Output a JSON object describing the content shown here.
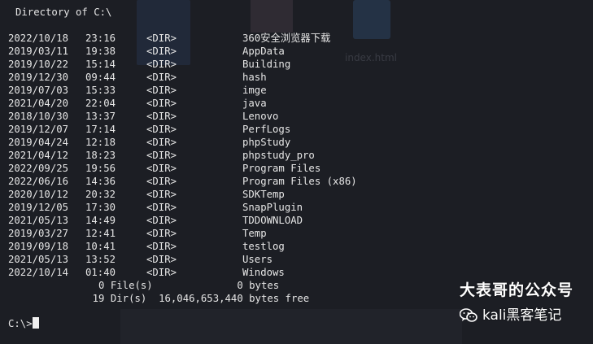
{
  "terminal": {
    "header": "Directory of C:\\",
    "tag": "<DIR>",
    "entries": [
      {
        "date": "2022/10/18",
        "time": "23:16",
        "name": "360安全浏览器下载"
      },
      {
        "date": "2019/03/11",
        "time": "19:38",
        "name": "AppData"
      },
      {
        "date": "2019/10/22",
        "time": "15:14",
        "name": "Building"
      },
      {
        "date": "2019/12/30",
        "time": "09:44",
        "name": "hash"
      },
      {
        "date": "2019/07/03",
        "time": "15:33",
        "name": "imge"
      },
      {
        "date": "2021/04/20",
        "time": "22:04",
        "name": "java"
      },
      {
        "date": "2018/10/30",
        "time": "13:37",
        "name": "Lenovo"
      },
      {
        "date": "2019/12/07",
        "time": "17:14",
        "name": "PerfLogs"
      },
      {
        "date": "2019/04/24",
        "time": "12:18",
        "name": "phpStudy"
      },
      {
        "date": "2021/04/12",
        "time": "18:23",
        "name": "phpstudy_pro"
      },
      {
        "date": "2022/09/25",
        "time": "19:56",
        "name": "Program Files"
      },
      {
        "date": "2022/06/16",
        "time": "14:36",
        "name": "Program Files (x86)"
      },
      {
        "date": "2020/10/12",
        "time": "20:32",
        "name": "SDKTemp"
      },
      {
        "date": "2019/12/05",
        "time": "17:30",
        "name": "SnapPlugin"
      },
      {
        "date": "2021/05/13",
        "time": "14:49",
        "name": "TDDOWNLOAD"
      },
      {
        "date": "2019/03/27",
        "time": "12:41",
        "name": "Temp"
      },
      {
        "date": "2019/09/18",
        "time": "10:41",
        "name": "testlog"
      },
      {
        "date": "2021/05/13",
        "time": "13:52",
        "name": "Users"
      },
      {
        "date": "2022/10/14",
        "time": "01:40",
        "name": "Windows"
      }
    ],
    "summary_files": "               0 File(s)              0 bytes",
    "summary_dirs": "              19 Dir(s)  16,046,653,440 bytes free",
    "prompt": "C:\\>"
  },
  "watermark": {
    "title": "大表哥的公众号",
    "subtitle": "kali黑客笔记",
    "icon": "wechat-icon"
  },
  "background": {
    "index_label": "index.html"
  },
  "colors": {
    "background": "#1c1e24",
    "text": "#e6e6e6",
    "cursor": "#f0f0f0",
    "watermark": "#ffffff"
  }
}
